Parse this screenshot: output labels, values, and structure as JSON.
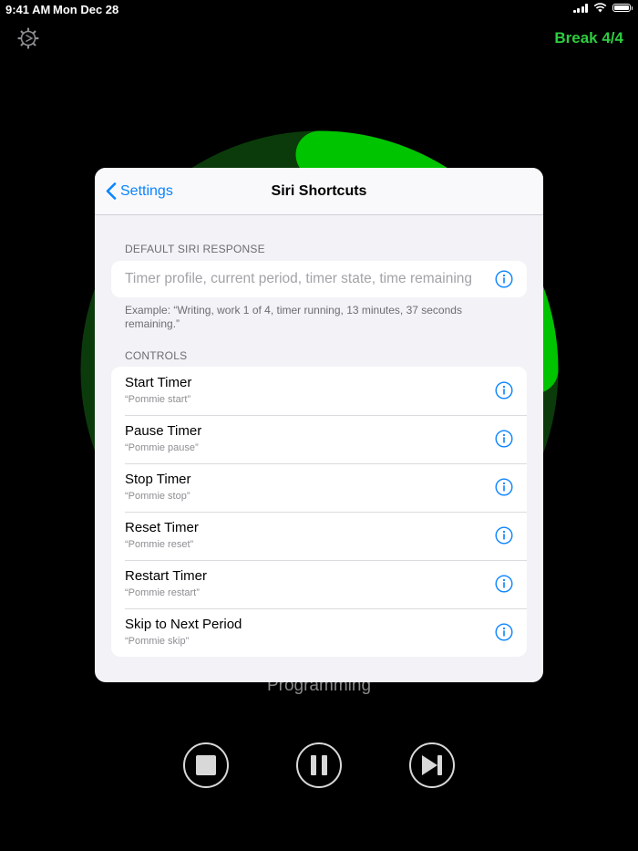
{
  "status_bar": {
    "time": "9:41 AM",
    "date": "Mon Dec 28",
    "battery_level": 1.0
  },
  "header": {
    "period_label": "Break 4/4",
    "settings_icon": "gear-icon"
  },
  "background": {
    "profile_name": "Programming",
    "ring_color": "#00c400",
    "ring_track_color": "#0a3a0a"
  },
  "controls": [
    {
      "name": "stop",
      "icon": "stop-icon"
    },
    {
      "name": "pause",
      "icon": "pause-icon"
    },
    {
      "name": "skip",
      "icon": "skip-forward-icon"
    }
  ],
  "modal": {
    "back_label": "Settings",
    "title": "Siri Shortcuts",
    "default_response": {
      "header": "DEFAULT SIRI RESPONSE",
      "placeholder": "Timer profile, current period, timer state, time remaining",
      "footer": "Example: “Writing, work 1 of 4, timer running, 13 minutes, 37 seconds remaining.”"
    },
    "controls_section": {
      "header": "CONTROLS",
      "items": [
        {
          "title": "Start Timer",
          "phrase": "“Pommie start”"
        },
        {
          "title": "Pause Timer",
          "phrase": "“Pommie pause”"
        },
        {
          "title": "Stop Timer",
          "phrase": "“Pommie stop”"
        },
        {
          "title": "Reset Timer",
          "phrase": "“Pommie reset”"
        },
        {
          "title": "Restart Timer",
          "phrase": "“Pommie restart”"
        },
        {
          "title": "Skip to Next Period",
          "phrase": "“Pommie skip”"
        }
      ]
    }
  },
  "colors": {
    "accent": "#0a84ff",
    "break_green": "#2ecc40"
  }
}
